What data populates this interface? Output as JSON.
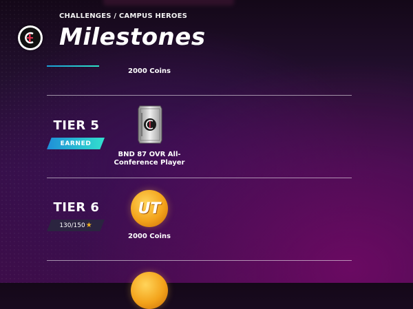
{
  "header": {
    "breadcrumb": "CHALLENGES / CAMPUS HEROES",
    "title": "Milestones"
  },
  "tiers": [
    {
      "tier": "",
      "reward_type": "coins",
      "reward_label": "2000 Coins"
    },
    {
      "tier": "TIER 5",
      "status": "EARNED",
      "reward_type": "player-pack",
      "reward_label": "BND 87 OVR All-Conference Player"
    },
    {
      "tier": "TIER 6",
      "progress": "130/150",
      "progress_icon": "star-icon",
      "reward_type": "coins",
      "reward_label": "2000 Coins",
      "coin_mark": "UT"
    }
  ],
  "colors": {
    "earned_badge": "#1f8fd8",
    "progress_accent": "#2ee6c9",
    "coin": "#f3a31b",
    "star": "#f1b421"
  }
}
